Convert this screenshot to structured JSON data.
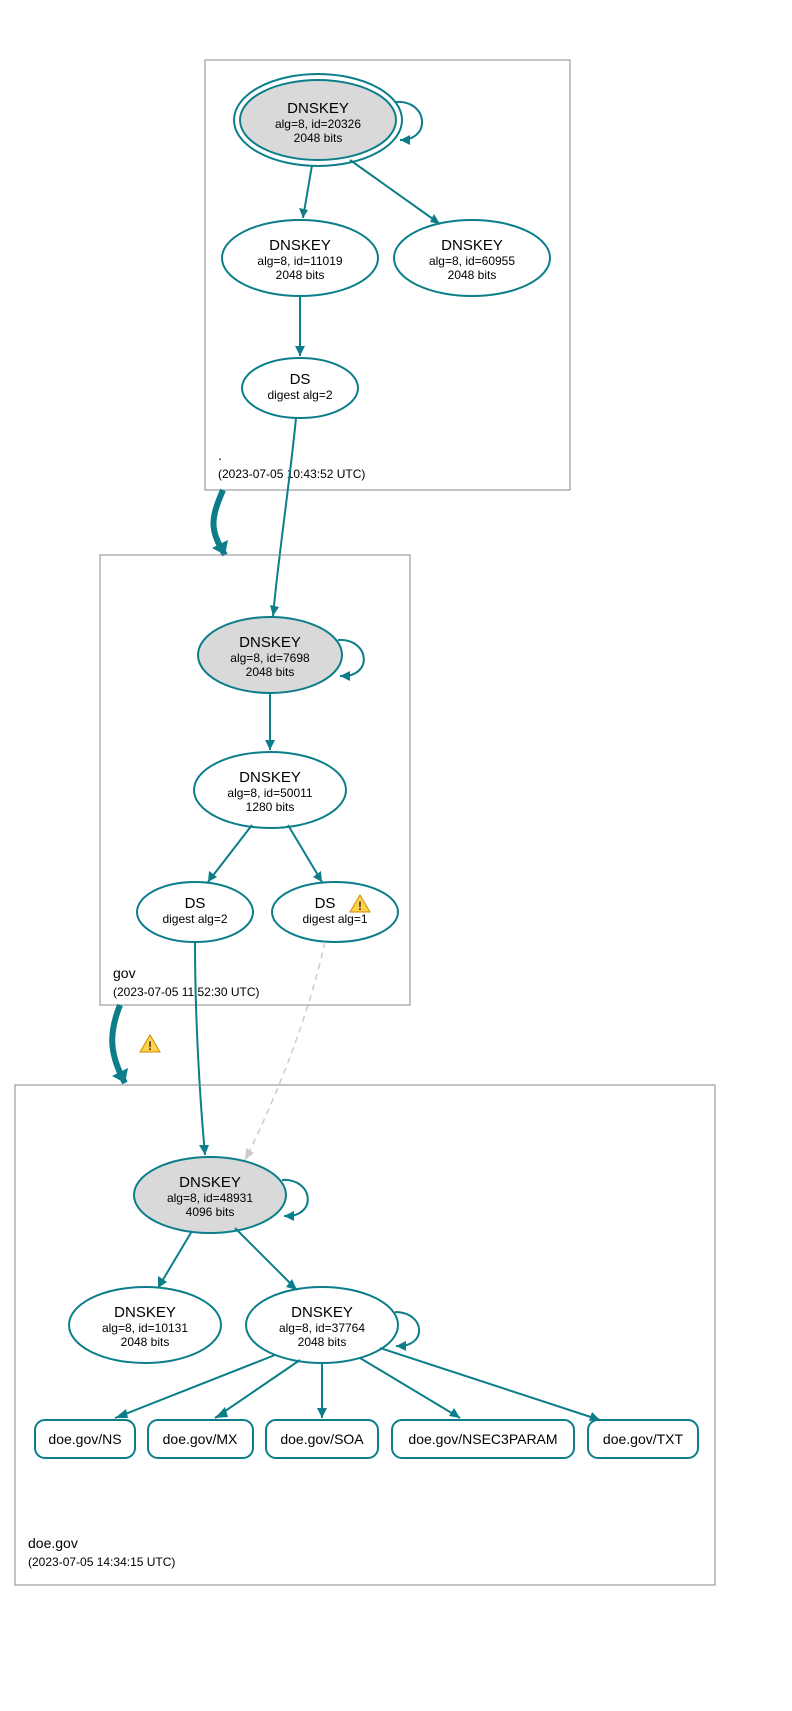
{
  "colors": {
    "stroke": "#0b7e8a",
    "keyfill": "#d9d9d9",
    "warn": "#ffd24a"
  },
  "zones": {
    "root": {
      "name_label": ".",
      "timestamp": "(2023-07-05 10:43:52 UTC)"
    },
    "gov": {
      "name_label": "gov",
      "timestamp": "(2023-07-05 11:52:30 UTC)"
    },
    "doe": {
      "name_label": "doe.gov",
      "timestamp": "(2023-07-05 14:34:15 UTC)"
    }
  },
  "nodes": {
    "root_ksk": {
      "title": "DNSKEY",
      "line2": "alg=8, id=20326",
      "line3": "2048 bits"
    },
    "root_zsk1": {
      "title": "DNSKEY",
      "line2": "alg=8, id=11019",
      "line3": "2048 bits"
    },
    "root_zsk2": {
      "title": "DNSKEY",
      "line2": "alg=8, id=60955",
      "line3": "2048 bits"
    },
    "root_ds": {
      "title": "DS",
      "line2": "digest alg=2"
    },
    "gov_ksk": {
      "title": "DNSKEY",
      "line2": "alg=8, id=7698",
      "line3": "2048 bits"
    },
    "gov_zsk": {
      "title": "DNSKEY",
      "line2": "alg=8, id=50011",
      "line3": "1280 bits"
    },
    "gov_ds1": {
      "title": "DS",
      "line2": "digest alg=2"
    },
    "gov_ds2": {
      "title": "DS",
      "line2": "digest alg=1"
    },
    "doe_ksk": {
      "title": "DNSKEY",
      "line2": "alg=8, id=48931",
      "line3": "4096 bits"
    },
    "doe_zsk1": {
      "title": "DNSKEY",
      "line2": "alg=8, id=10131",
      "line3": "2048 bits"
    },
    "doe_zsk2": {
      "title": "DNSKEY",
      "line2": "alg=8, id=37764",
      "line3": "2048 bits"
    }
  },
  "rrsets": {
    "ns": "doe.gov/NS",
    "mx": "doe.gov/MX",
    "soa": "doe.gov/SOA",
    "nsec3": "doe.gov/NSEC3PARAM",
    "txt": "doe.gov/TXT"
  }
}
